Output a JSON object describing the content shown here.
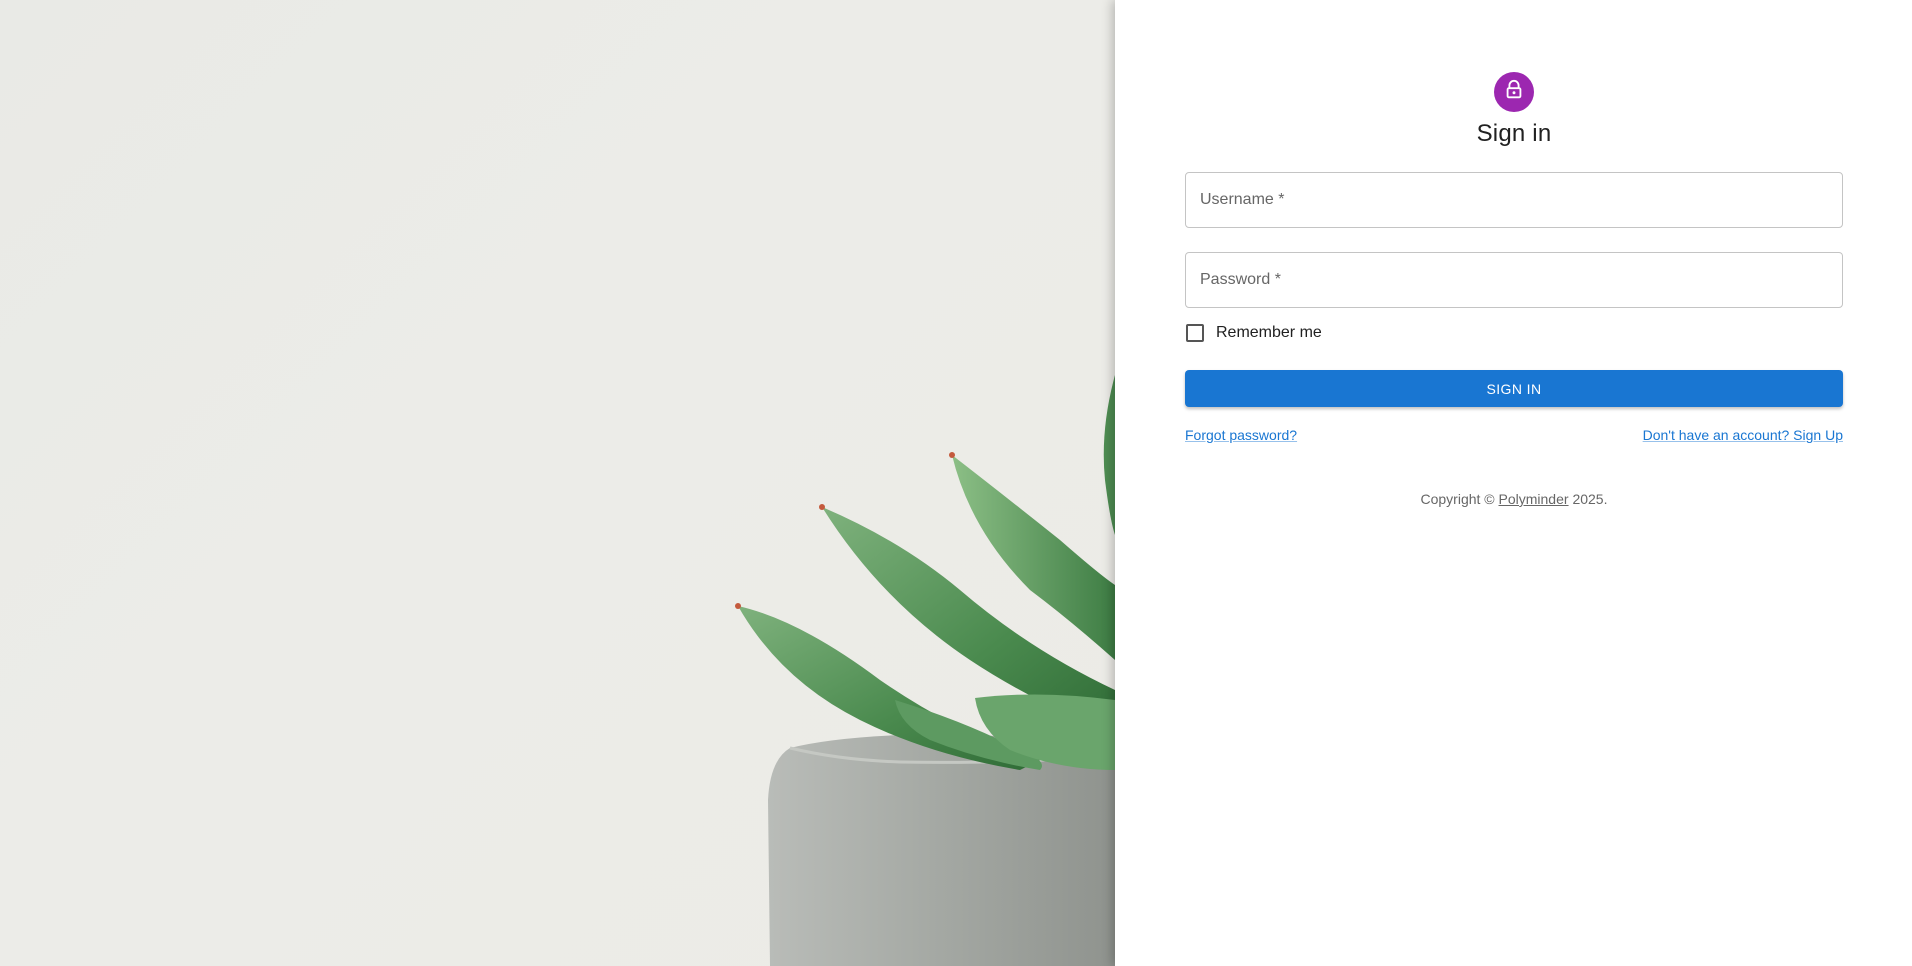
{
  "signin": {
    "title": "Sign in",
    "lock_icon": "lock-icon",
    "accent_color": "#9c27b0",
    "fields": {
      "username_label": "Username *",
      "password_label": "Password *",
      "username_value": "",
      "password_value": ""
    },
    "remember_label": "Remember me",
    "remember_checked": false,
    "submit_label": "SIGN IN",
    "button_color": "#1976d2",
    "links": {
      "forgot": "Forgot password?",
      "signup": "Don't have an account? Sign Up"
    },
    "copyright": {
      "prefix": "Copyright ©",
      "brand": "Polyminder",
      "suffix": "2025."
    }
  },
  "hero": {
    "image_subject": "succulent-plant-in-concrete-pot"
  }
}
